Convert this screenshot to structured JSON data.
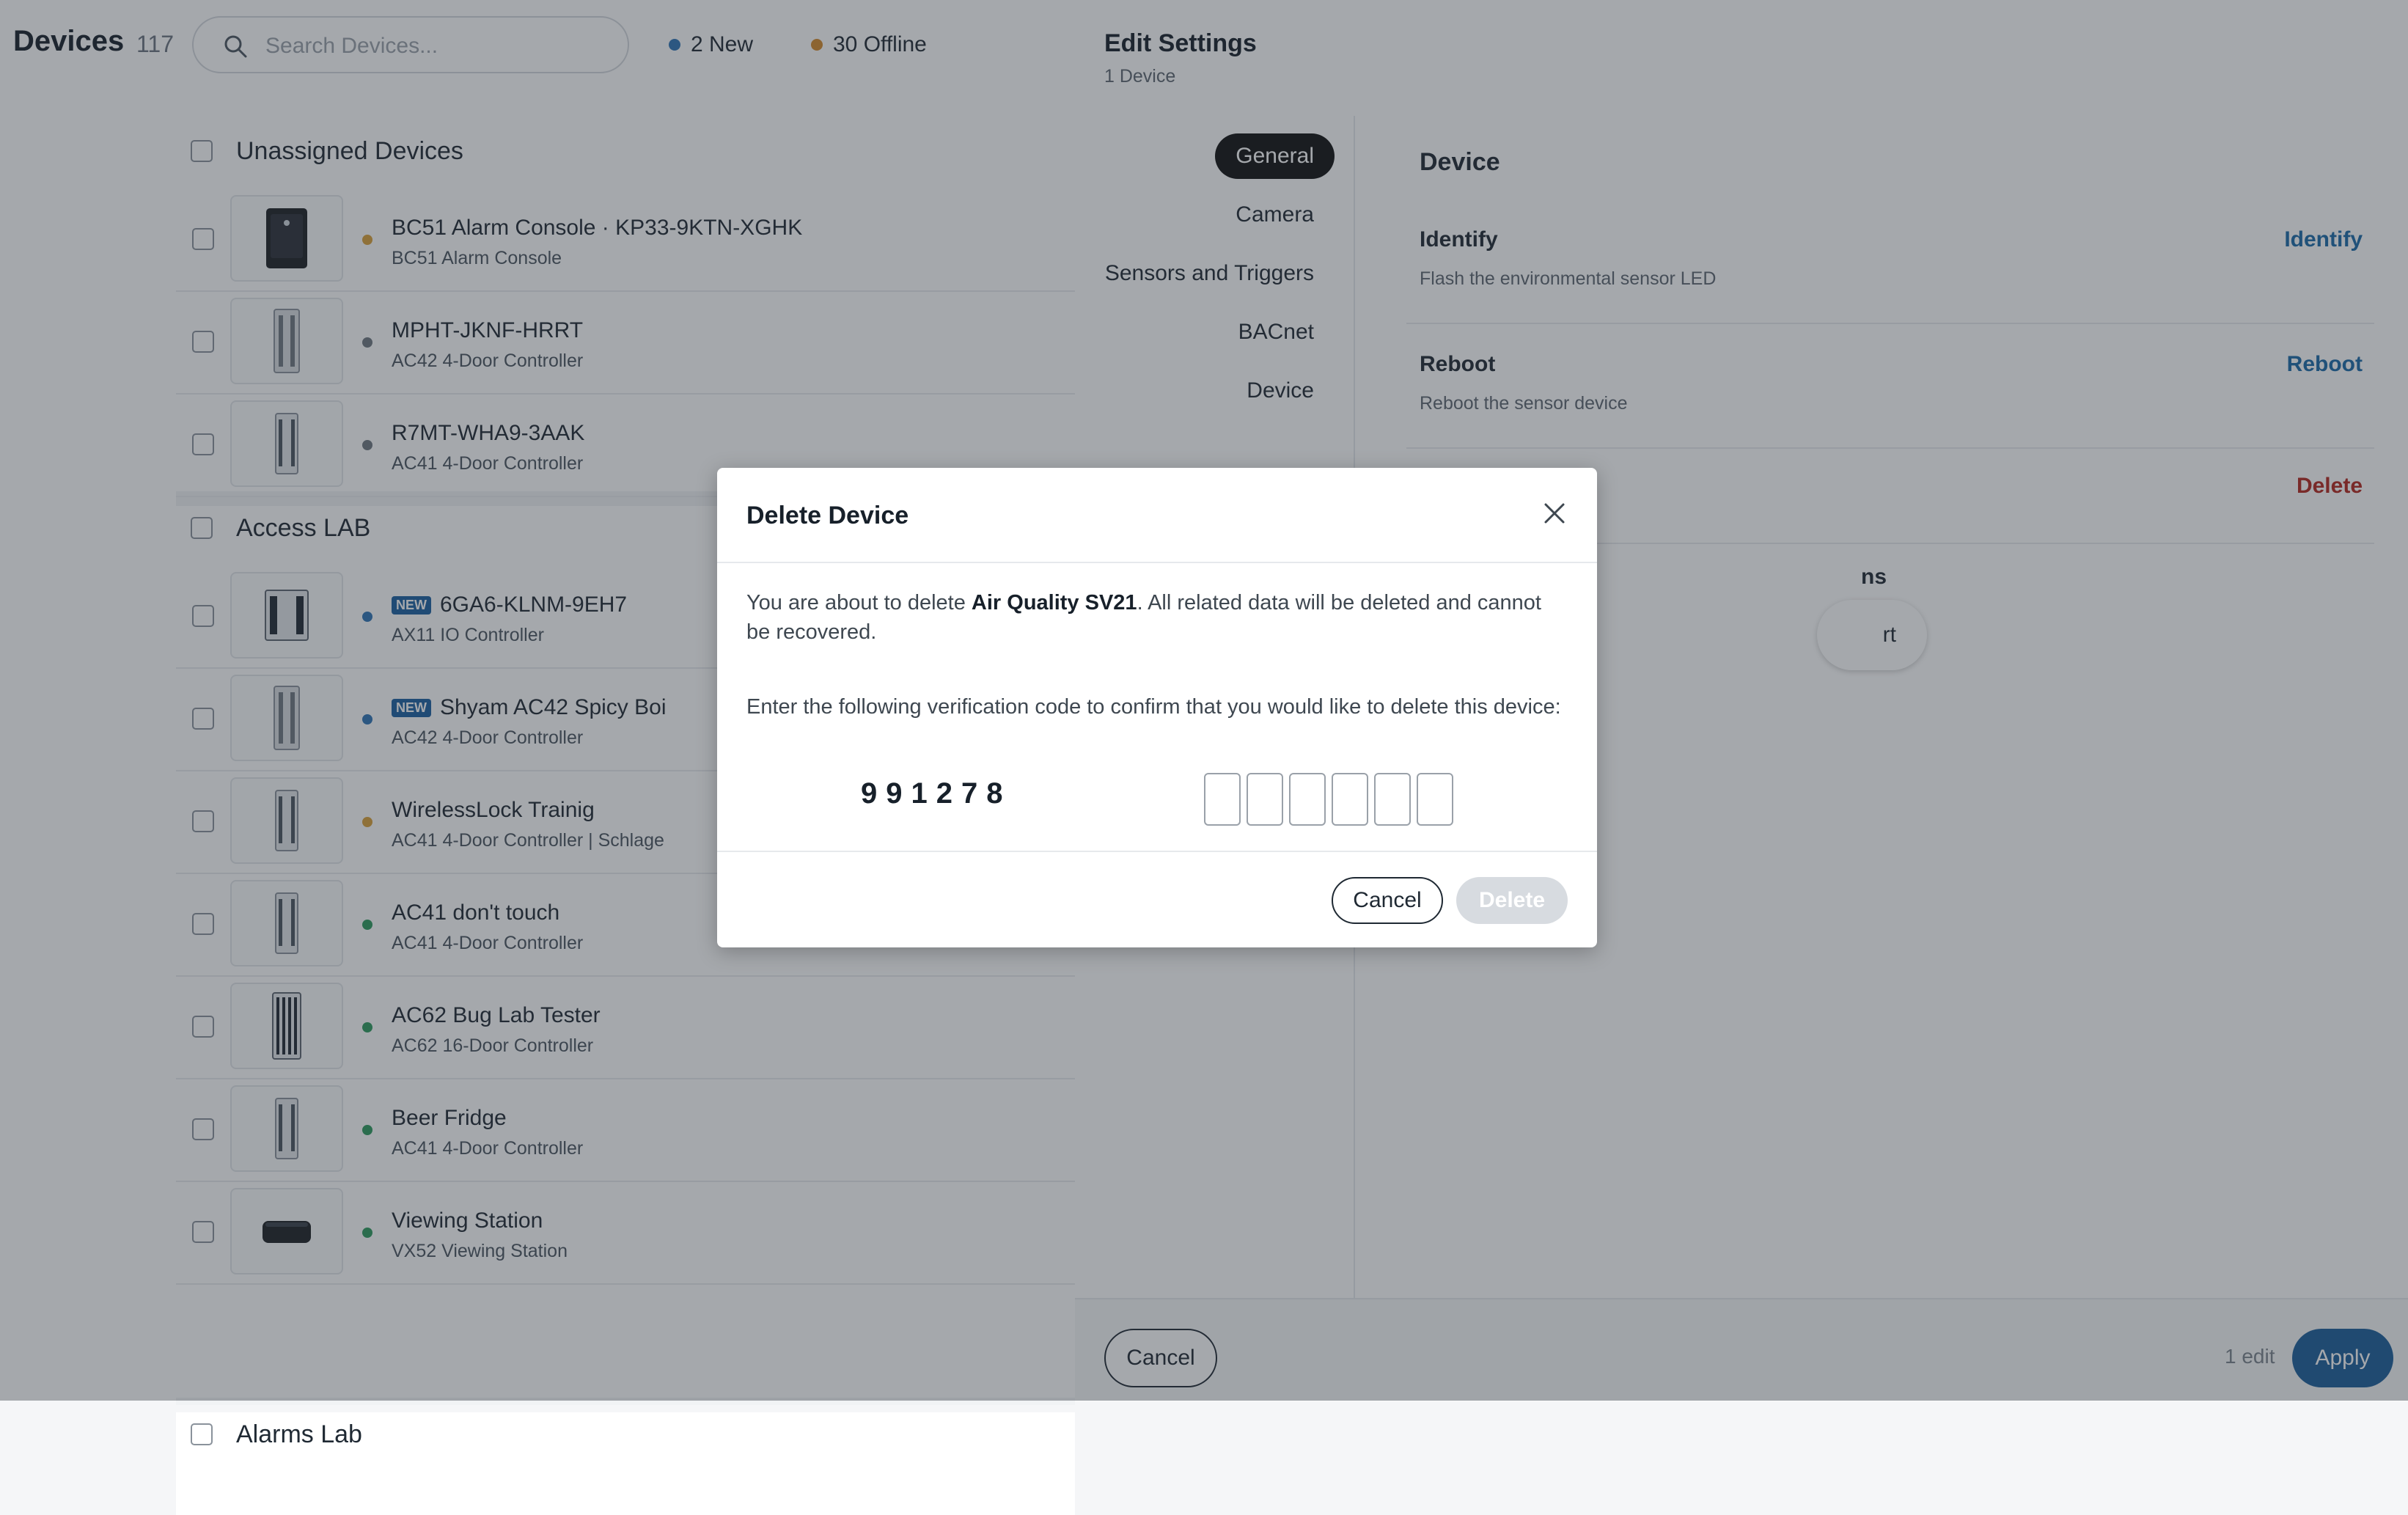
{
  "header": {
    "title": "Devices",
    "count": "117",
    "search_placeholder": "Search Devices...",
    "new_label": "2 New",
    "offline_label": "30 Offline",
    "new_dot_color": "#2f74b5",
    "offline_dot_color": "#d58a2c"
  },
  "groups": [
    {
      "title": "Unassigned Devices",
      "devices": [
        {
          "name": "BC51 Alarm Console · KP33-9KTN-XGHK",
          "sub": "BC51 Alarm Console",
          "status": "#d9a13a",
          "icon": "alarm-console-icon",
          "new": false
        },
        {
          "name": "MPHT-JKNF-HRRT",
          "sub": "AC42 4-Door Controller",
          "status": "#6e7780",
          "icon": "door-controller-icon",
          "new": false
        },
        {
          "name": "R7MT-WHA9-3AAK",
          "sub": "AC41 4-Door Controller",
          "status": "#6e7780",
          "icon": "door-controller-icon",
          "new": false
        }
      ]
    },
    {
      "title": "Access LAB",
      "devices": [
        {
          "name": "6GA6-KLNM-9EH7",
          "sub": "AX11 IO Controller",
          "status": "#2f74b5",
          "icon": "io-controller-icon",
          "new": true
        },
        {
          "name": "Shyam AC42 Spicy Boi",
          "sub": "AC42 4-Door Controller",
          "status": "#2f74b5",
          "icon": "door-controller-icon",
          "new": true
        },
        {
          "name": "WirelessLock Trainig",
          "sub": "AC41 4-Door Controller | Schlage",
          "status": "#d9a13a",
          "icon": "door-controller-icon",
          "new": false
        },
        {
          "name": "AC41 don't touch",
          "sub": "AC41 4-Door Controller",
          "status": "#2e9a5e",
          "icon": "door-controller-icon",
          "new": false
        },
        {
          "name": "AC62 Bug Lab Tester",
          "sub": "AC62 16-Door Controller",
          "status": "#2e9a5e",
          "icon": "door-controller-16-icon",
          "new": false
        },
        {
          "name": "Beer Fridge",
          "sub": "AC41 4-Door Controller",
          "status": "#2e9a5e",
          "icon": "door-controller-icon",
          "new": false
        },
        {
          "name": "Viewing Station",
          "sub": "VX52 Viewing Station",
          "status": "#2e9a5e",
          "icon": "viewing-station-icon",
          "new": false
        }
      ]
    },
    {
      "title": "Alarms Lab",
      "devices": []
    }
  ],
  "new_badge": "NEW",
  "panel": {
    "title": "Edit Settings",
    "subtitle": "1 Device",
    "nav": [
      "General",
      "Camera",
      "Sensors and Triggers",
      "BACnet",
      "Device"
    ],
    "section_title": "Device",
    "settings": [
      {
        "label": "Identify",
        "desc": "Flash the environmental sensor LED",
        "action": "Identify"
      },
      {
        "label": "Reboot",
        "desc": "Reboot the sensor device",
        "action": "Reboot"
      },
      {
        "label": "",
        "desc": "",
        "action": "Delete"
      }
    ],
    "partial_label": "ns",
    "partial_button": "rt",
    "footer": {
      "cancel": "Cancel",
      "edits": "1 edit",
      "apply": "Apply"
    }
  },
  "modal": {
    "title": "Delete Device",
    "text_before": "You are about to delete ",
    "device_name": "Air Quality SV21",
    "text_after": ". All related data will be deleted and cannot be recovered.",
    "prompt": "Enter the following verification code to confirm that you would like to delete this device:",
    "code": "991278",
    "cancel": "Cancel",
    "delete": "Delete"
  }
}
